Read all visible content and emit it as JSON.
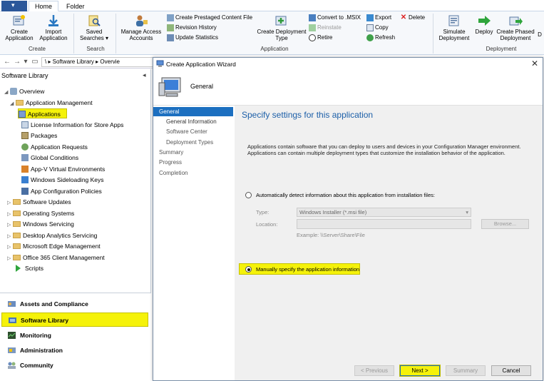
{
  "ribbon": {
    "tabs": [
      "Home",
      "Folder"
    ],
    "buttons": {
      "create_application": "Create Application",
      "import_application": "Import Application",
      "saved_searches": "Saved Searches ▾",
      "manage_access": "Manage Access Accounts",
      "create_prestaged": "Create Prestaged Content File",
      "revision_history": "Revision History",
      "update_statistics": "Update Statistics",
      "create_deployment_type": "Create Deployment Type",
      "convert_msix": "Convert to .MSIX",
      "reinstate": "Reinstate",
      "retire": "Retire",
      "export": "Export",
      "copy": "Copy",
      "refresh": "Refresh",
      "delete": "Delete",
      "simulate_deployment": "Simulate Deployment",
      "deploy": "Deploy",
      "create_phased": "Create Phased Deployment",
      "truncated": "D"
    },
    "groups": {
      "create": "Create",
      "search": "Search",
      "application": "Application",
      "deployment": "Deployment"
    }
  },
  "navbar": {
    "breadcrumb": "\\  ▸  Software Library  ▸  Overvie"
  },
  "left_pane": {
    "title": "Software Library",
    "tree": [
      {
        "label": "Overview"
      },
      {
        "label": "Application Management"
      },
      {
        "label": "Applications"
      },
      {
        "label": "License Information for Store Apps"
      },
      {
        "label": "Packages"
      },
      {
        "label": "Application Requests"
      },
      {
        "label": "Global Conditions"
      },
      {
        "label": "App-V Virtual Environments"
      },
      {
        "label": "Windows Sideloading Keys"
      },
      {
        "label": "App Configuration Policies"
      },
      {
        "label": "Software Updates"
      },
      {
        "label": "Operating Systems"
      },
      {
        "label": "Windows Servicing"
      },
      {
        "label": "Desktop Analytics Servicing"
      },
      {
        "label": "Microsoft Edge Management"
      },
      {
        "label": "Office 365 Client Management"
      },
      {
        "label": "Scripts"
      }
    ],
    "workspaces": [
      {
        "label": "Assets and Compliance"
      },
      {
        "label": "Software Library"
      },
      {
        "label": "Monitoring"
      },
      {
        "label": "Administration"
      },
      {
        "label": "Community"
      }
    ]
  },
  "wizard": {
    "title": "Create Application Wizard",
    "header": "General",
    "steps": [
      {
        "label": "General"
      },
      {
        "label": "General Information"
      },
      {
        "label": "Software Center"
      },
      {
        "label": "Deployment Types"
      },
      {
        "label": "Summary"
      },
      {
        "label": "Progress"
      },
      {
        "label": "Completion"
      }
    ],
    "heading": "Specify settings for this application",
    "description": "Applications contain software that you can deploy to users and devices in your Configuration Manager environment. Applications can contain multiple deployment types that customize the installation behavior of the application.",
    "auto_detect_label": "Automatically detect information about this application from installation files:",
    "type_label": "Type:",
    "type_value": "Windows Installer (*.msi file)",
    "location_label": "Location:",
    "location_value": "",
    "location_example": "Example: \\\\Server\\Share\\File",
    "browse": "Browse...",
    "manual_label": "Manually specify the application information",
    "buttons": {
      "previous": "< Previous",
      "next": "Next >",
      "summary": "Summary",
      "cancel": "Cancel"
    }
  }
}
